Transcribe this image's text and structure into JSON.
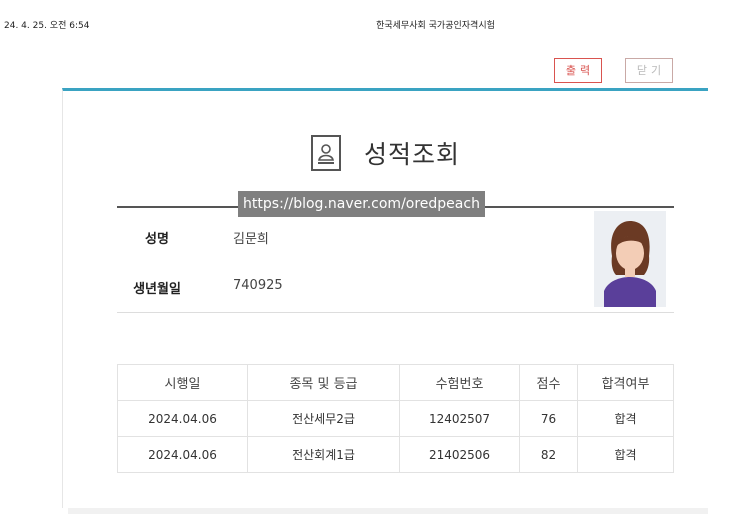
{
  "print_header": {
    "date": "24. 4. 25. 오전 6:54",
    "title": "한국세무사회 국가공인자격시험"
  },
  "buttons": {
    "print": "출력",
    "close": "닫기"
  },
  "page": {
    "title": "성적조회",
    "title_icon": "id-card-icon"
  },
  "info": {
    "name_label": "성명",
    "name_value": "김문희",
    "birth_label": "생년월일",
    "birth_value": "740925"
  },
  "watermark": "https://blog.naver.com/oredpeach",
  "table": {
    "headers": [
      "시행일",
      "종목 및 등급",
      "수험번호",
      "점수",
      "합격여부"
    ],
    "rows": [
      [
        "2024.04.06",
        "전산세무2급",
        "12402507",
        "76",
        "합격"
      ],
      [
        "2024.04.06",
        "전산회계1급",
        "21402506",
        "82",
        "합격"
      ]
    ]
  },
  "colors": {
    "accent": "#3aa3c2",
    "button_red": "#d9534f"
  }
}
